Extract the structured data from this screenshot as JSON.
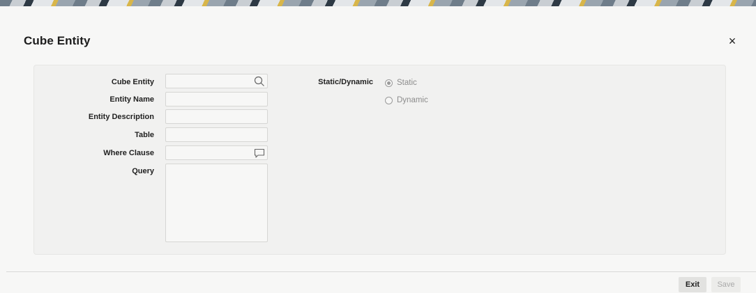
{
  "window": {
    "title": "Cube Entity",
    "close_icon": "close-icon",
    "close_glyph": "×"
  },
  "form": {
    "cube_entity_label": "Cube Entity",
    "cube_entity_value": "",
    "entity_name_label": "Entity Name",
    "entity_name_value": "",
    "entity_description_label": "Entity Description",
    "entity_description_value": "",
    "table_label": "Table",
    "table_value": "",
    "where_clause_label": "Where Clause",
    "where_clause_value": "",
    "query_label": "Query",
    "query_value": "",
    "static_dynamic_label": "Static/Dynamic",
    "static_label": "Static",
    "dynamic_label": "Dynamic",
    "selected_option": "Static"
  },
  "footer": {
    "exit_label": "Exit",
    "save_label": "Save"
  }
}
